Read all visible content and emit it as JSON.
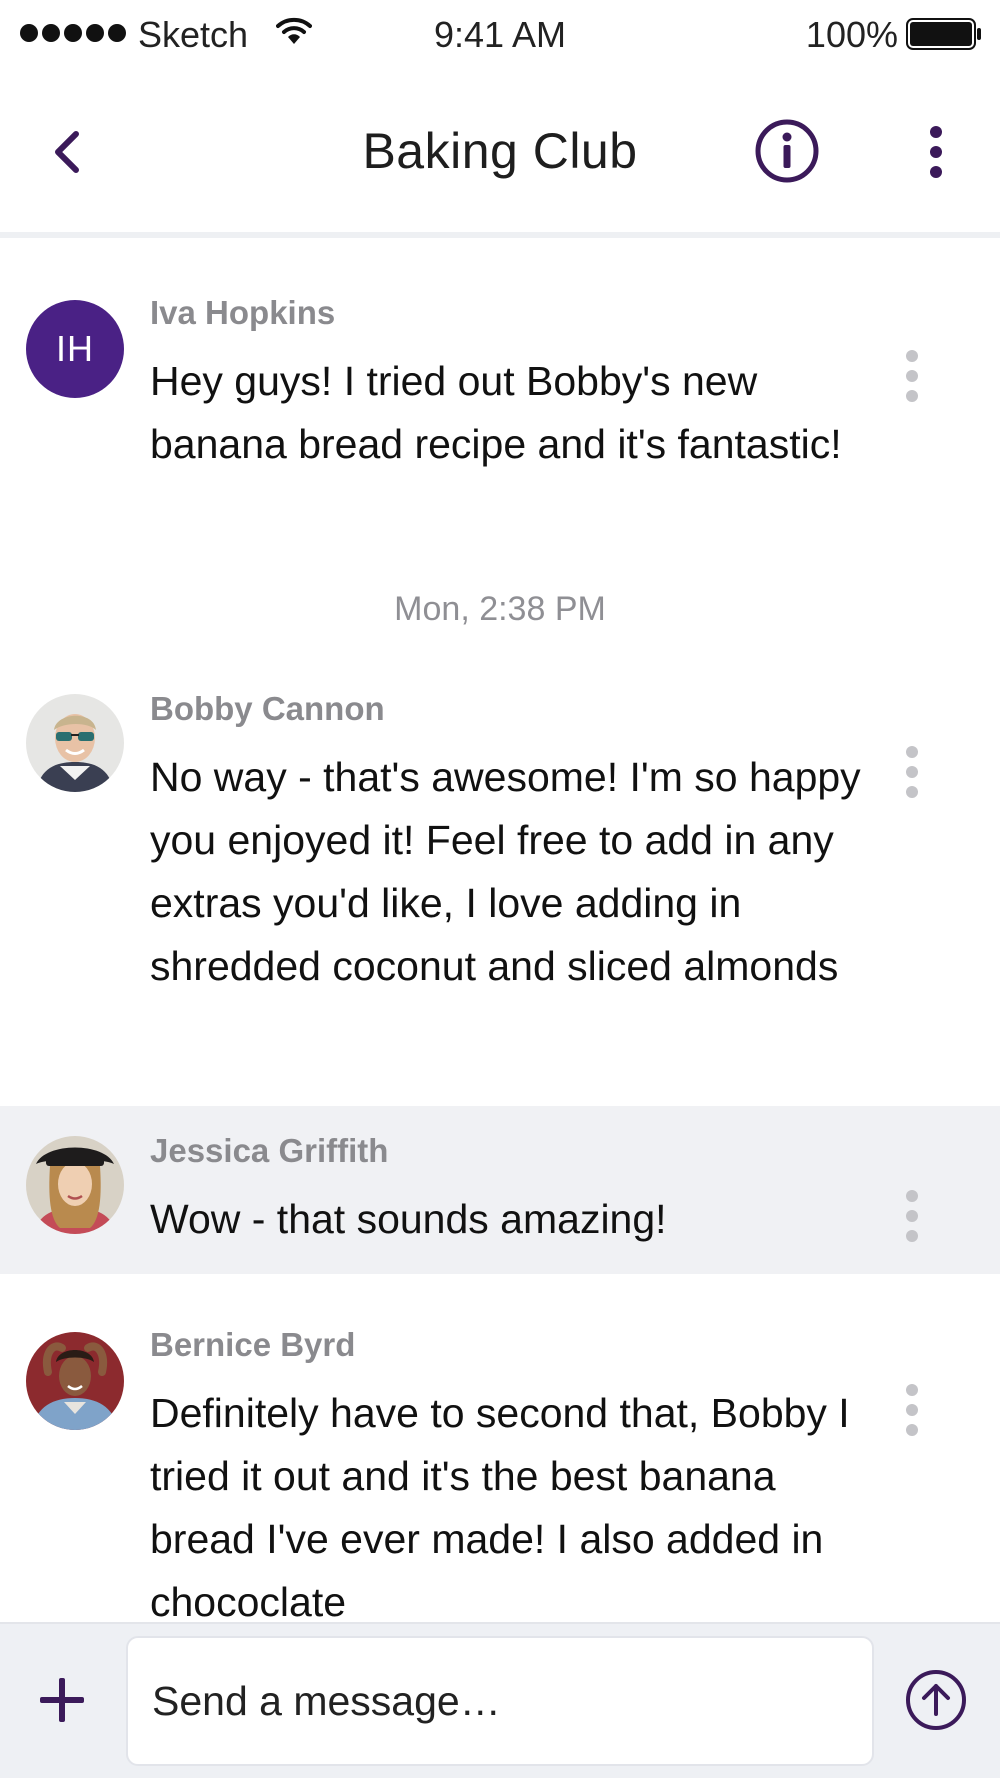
{
  "status_bar": {
    "carrier": "Sketch",
    "time": "9:41 AM",
    "battery": "100%"
  },
  "header": {
    "title": "Baking Club",
    "back_icon": "chevron-left-icon",
    "info_icon": "info-circle-icon",
    "more_icon": "vertical-ellipsis-icon"
  },
  "messages": [
    {
      "sender": "Iva Hopkins",
      "initials": "IH",
      "text": "Hey guys! I tried out Bobby's new banana bread recipe and it's fantastic!"
    },
    {
      "sender": "Bobby Cannon",
      "text": "No way - that's awesome! I'm so happy you enjoyed it! Feel free to add in any extras you'd like, I love adding in shredded coconut and sliced almonds"
    },
    {
      "sender": "Jessica Griffith",
      "text": "Wow - that sounds amazing!"
    },
    {
      "sender": "Bernice Byrd",
      "text": "Definitely have to second that, Bobby I tried it out and it's the best banana bread I've ever made! I also added in chococlate"
    }
  ],
  "timestamp": "Mon, 2:38 PM",
  "composer": {
    "placeholder": "Send a message…",
    "add_icon": "plus-icon",
    "send_icon": "send-arrow-up-icon"
  },
  "colors": {
    "accent": "#4a2185",
    "icon_dark": "#3b1a5a",
    "highlight_bg": "#f0f1f4"
  }
}
